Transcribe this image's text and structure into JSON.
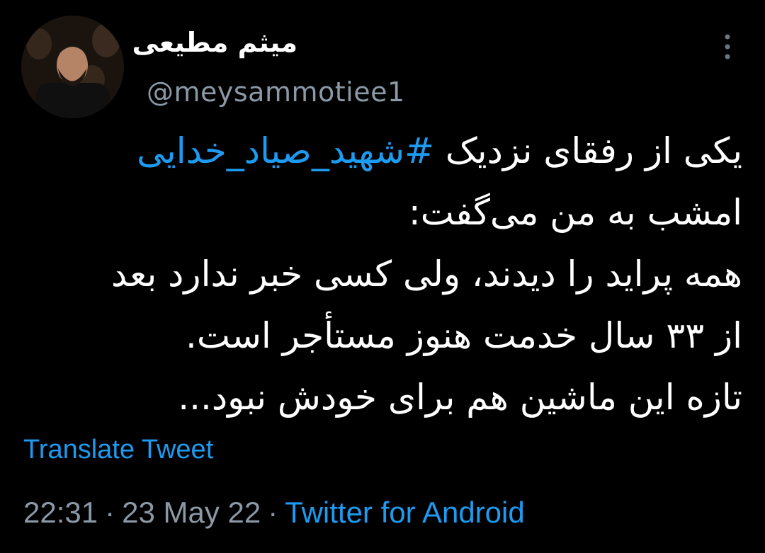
{
  "author": {
    "display_name": "میثم مطیعی",
    "handle": "@meysammotiee1"
  },
  "tweet": {
    "line1_prefix": "یکی از رفقای نزدیک ",
    "hashtag": "#شهید_صیاد_خدایی",
    "line2": "امشب به من می‌گفت:",
    "line3": "همه پراید را دیدند، ولی کسی خبر ندارد بعد",
    "line4": "از ۳۳ سال خدمت هنوز مستأجر است.",
    "line5": "تازه این ماشین هم برای خودش نبود..."
  },
  "actions": {
    "translate_label": "Translate Tweet"
  },
  "meta": {
    "time": "22:31",
    "separator": "·",
    "date": "23 May 22",
    "source": "Twitter for Android"
  },
  "icons": {
    "more": "more-vertical-icon"
  },
  "colors": {
    "background": "#000000",
    "text": "#ffffff",
    "secondary": "#8b98a5",
    "accent": "#1d9bf0"
  }
}
